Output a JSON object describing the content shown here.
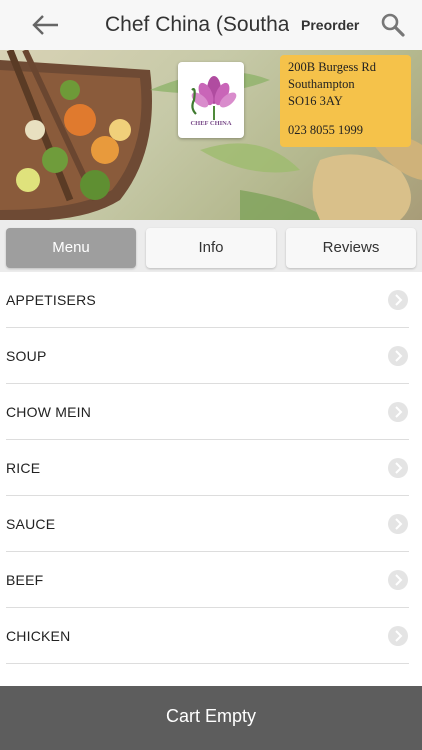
{
  "header": {
    "title": "Chef China (Southampton)",
    "preorder_label": "Preorder",
    "back_icon": "arrow-left-icon",
    "search_icon": "search-icon"
  },
  "banner": {
    "logo_text": "CHEF CHINA",
    "address_lines": [
      "200B Burgess Rd",
      "Southampton",
      "SO16 3AY"
    ],
    "phone": "023 8055 1999",
    "address_card_color": "#f5c24a"
  },
  "tabs": [
    {
      "label": "Menu",
      "active": true
    },
    {
      "label": "Info",
      "active": false
    },
    {
      "label": "Reviews",
      "active": false
    }
  ],
  "menu": {
    "categories": [
      "APPETISERS",
      "SOUP",
      "CHOW MEIN",
      "RICE",
      "SAUCE",
      "BEEF",
      "CHICKEN"
    ]
  },
  "cart": {
    "label": "Cart Empty"
  },
  "colors": {
    "active_tab": "#9e9e9e",
    "cart_bar": "#5d5d5d"
  }
}
